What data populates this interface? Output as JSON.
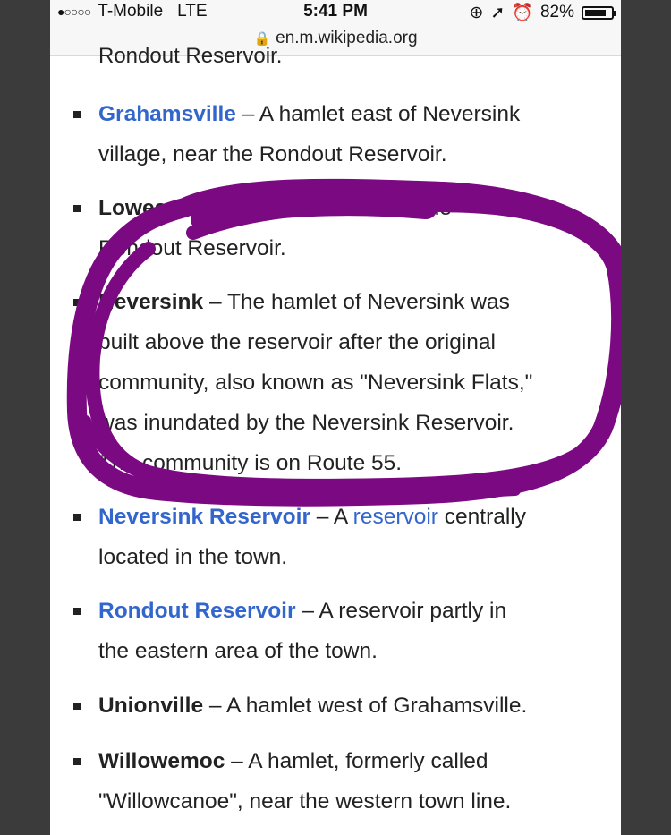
{
  "status_bar": {
    "signal": "●○○○○",
    "carrier": "T-Mobile",
    "network": "LTE",
    "time": "5:41 PM",
    "battery": "82%",
    "battery_level": 0.82
  },
  "address_bar": {
    "url": "en.m.wikipedia.org"
  },
  "top_clipped_text": "Rondout Reservoir.",
  "entries": [
    {
      "name": "Grahamsville",
      "link": true,
      "line1": " – A hamlet east of Neversink",
      "line2": "village, near the Rondout Reservoir."
    },
    {
      "name": "Lowes Corners",
      "link": false,
      "line1": " – A hamlet near the",
      "line2": "Rondout Reservoir."
    },
    {
      "name": "Neversink",
      "link": false,
      "line1": " – The hamlet of Neversink was",
      "line2": "built above the reservoir after the original",
      "line3": "community, also known as \"Neversink Flats,\"",
      "line4": "was inundated by the Neversink Reservoir.",
      "line5": "The community is on Route 55."
    },
    {
      "name": "Neversink Reservoir",
      "link": true,
      "sep": " – A ",
      "inline_link": "reservoir",
      "line1_tail": " centrally",
      "line2": "located in the town."
    },
    {
      "name": "Rondout Reservoir",
      "link": true,
      "line1": " – A reservoir partly in",
      "line2": "the eastern area of the town."
    },
    {
      "name": "Unionville",
      "link": false,
      "line1": " – A hamlet west of Grahamsville."
    },
    {
      "name": "Willowemoc",
      "link": false,
      "line1": " – A hamlet, formerly called",
      "line2": "\"Willowcanoe\", near the western town line."
    }
  ],
  "annotation_color": "#7b0a82"
}
